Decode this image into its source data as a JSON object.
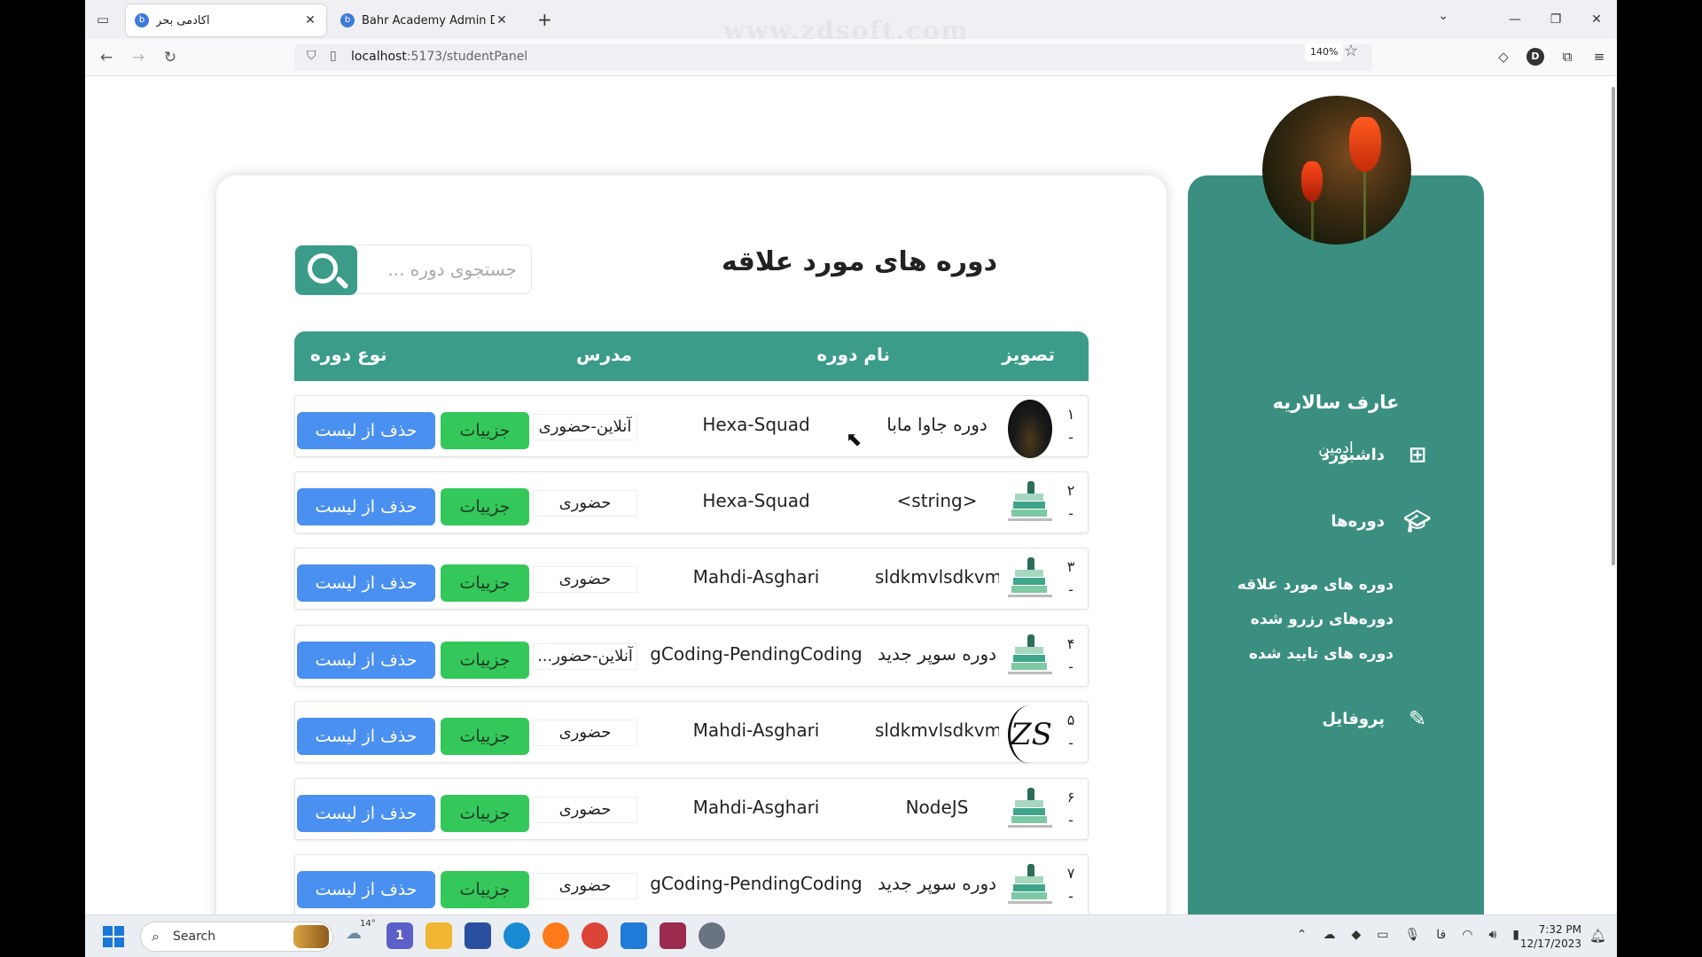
{
  "browser": {
    "tabs": [
      {
        "title": "آکادمی بحر",
        "active": true
      },
      {
        "title": "Bahr Academy Admin Dashboa",
        "active": false
      }
    ],
    "url_host": "localhost",
    "url_path": ":5173/studentPanel",
    "zoom": "140%",
    "profile_initial": "D",
    "watermark": "www.zdsoft.com"
  },
  "sidebar": {
    "user_name": "عارف سالاریه",
    "user_role": "ادمین",
    "items": [
      {
        "label": "داشبورد",
        "icon": "dashboard-icon"
      },
      {
        "label": "دوره‌ها",
        "icon": "graduation-cap-icon"
      },
      {
        "label": "پروفایل",
        "icon": "edit-icon"
      }
    ],
    "sub_items": [
      {
        "label": "دوره های مورد علاقه"
      },
      {
        "label": "دوره‌های رزرو شده"
      },
      {
        "label": "دوره های تایید شده"
      }
    ]
  },
  "main": {
    "title": "دوره های مورد علاقه",
    "search_placeholder": "جستجوی دوره ...",
    "columns": {
      "image": "تصویز",
      "course_name": "نام دوره",
      "teacher": "مدرس",
      "course_type": "نوع دوره"
    },
    "buttons": {
      "details": "جزییات",
      "remove": "حذف از لیست"
    },
    "rows": [
      {
        "index": "۱",
        "dash": "-",
        "image": "dark",
        "name": "دوره جاوا مابا",
        "teacher": "Hexa-Squad",
        "type": "آنلاین-حضوری"
      },
      {
        "index": "۲",
        "dash": "-",
        "image": "book",
        "name": "<string>",
        "teacher": "Hexa-Squad",
        "type": "حضوری"
      },
      {
        "index": "۳",
        "dash": "-",
        "image": "book",
        "name": "sldkmvlsdkvm...",
        "teacher": "Mahdi-Asghari",
        "type": "حضوری"
      },
      {
        "index": "۴",
        "dash": "-",
        "image": "book",
        "name": "دوره سوپر جدید",
        "teacher": "gCoding-PendingCoding",
        "type": "آنلاین-حضور..."
      },
      {
        "index": "۵",
        "dash": "-",
        "image": "zs",
        "name": "sldkmvlsdkvm...",
        "teacher": "Mahdi-Asghari",
        "type": "حضوری"
      },
      {
        "index": "۶",
        "dash": "-",
        "image": "book",
        "name": "NodeJS",
        "teacher": "Mahdi-Asghari",
        "type": "حضوری"
      },
      {
        "index": "۷",
        "dash": "-",
        "image": "book",
        "name": "دوره سوپر جدید",
        "teacher": "gCoding-PendingCoding",
        "type": "حضوری"
      }
    ]
  },
  "taskbar": {
    "search_label": "Search",
    "temperature": "14°",
    "time": "7:32 PM",
    "date": "12/17/2023",
    "lang": "فا",
    "chat_badge": "1"
  }
}
